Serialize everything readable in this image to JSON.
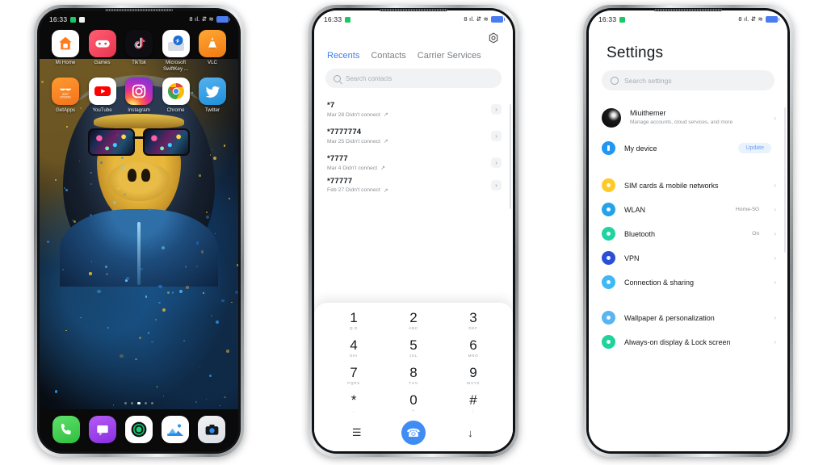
{
  "statusbar": {
    "time": "16:33",
    "signal_icons": "8 ıl. ⇵ ≋",
    "battery": "battery-full"
  },
  "phone1": {
    "name": "home-screen",
    "apps_row1": [
      {
        "label": "Mi Home",
        "icon": "mi-home-icon"
      },
      {
        "label": "Games",
        "icon": "games-icon"
      },
      {
        "label": "TikTok",
        "icon": "tiktok-icon"
      },
      {
        "label": "Microsoft SwiftKey ...",
        "icon": "swiftkey-icon"
      },
      {
        "label": "VLC",
        "icon": "vlc-icon"
      }
    ],
    "apps_row2": [
      {
        "label": "GetApps",
        "icon": "getapps-icon"
      },
      {
        "label": "YouTube",
        "icon": "youtube-icon"
      },
      {
        "label": "Instagram",
        "icon": "instagram-icon"
      },
      {
        "label": "Chrome",
        "icon": "chrome-icon"
      },
      {
        "label": "Twitter",
        "icon": "twitter-icon"
      }
    ],
    "dock": [
      {
        "label": "Phone",
        "icon": "phone-icon"
      },
      {
        "label": "Messages",
        "icon": "messages-icon"
      },
      {
        "label": "Security",
        "icon": "security-icon"
      },
      {
        "label": "Gallery",
        "icon": "gallery-icon"
      },
      {
        "label": "Camera",
        "icon": "camera-icon"
      }
    ],
    "page_dots": 5,
    "active_dot": 2,
    "wallpaper": "gorilla-in-hoodie-with-rainbow-sunglasses"
  },
  "phone2": {
    "name": "dialer-app",
    "settings_icon": "gear-icon",
    "tabs": [
      {
        "label": "Recents",
        "active": true
      },
      {
        "label": "Contacts",
        "active": false
      },
      {
        "label": "Carrier Services",
        "active": false
      }
    ],
    "search_placeholder": "Search contacts",
    "calls": [
      {
        "number": "*7",
        "detail": "Mar 28 Didn't connect"
      },
      {
        "number": "*7777774",
        "detail": "Mar 25 Didn't connect"
      },
      {
        "number": "*7777",
        "detail": "Mar 4 Didn't connect"
      },
      {
        "number": "*77777",
        "detail": "Feb 27 Didn't connect"
      }
    ],
    "keypad": [
      {
        "digit": "1",
        "letters": "Q,D"
      },
      {
        "digit": "2",
        "letters": "ABC"
      },
      {
        "digit": "3",
        "letters": "DEF"
      },
      {
        "digit": "4",
        "letters": "GHI"
      },
      {
        "digit": "5",
        "letters": "JKL"
      },
      {
        "digit": "6",
        "letters": "MNO"
      },
      {
        "digit": "7",
        "letters": "PQRS"
      },
      {
        "digit": "8",
        "letters": "TUV"
      },
      {
        "digit": "9",
        "letters": "WXYZ"
      },
      {
        "digit": "*",
        "letters": ","
      },
      {
        "digit": "0",
        "letters": "+"
      },
      {
        "digit": "#",
        "letters": ";"
      }
    ],
    "actions": {
      "menu": "menu-icon",
      "call": "call-button",
      "hide": "hide-keypad-icon"
    },
    "accent": "#3f8cf5"
  },
  "phone3": {
    "name": "settings-app",
    "title": "Settings",
    "search_placeholder": "Search settings",
    "account": {
      "name": "Miuithemer",
      "subtitle": "Manage accounts, cloud services, and more"
    },
    "device": {
      "label": "My device",
      "badge": "Update",
      "icon_color": "#2196f3"
    },
    "items_group1": [
      {
        "label": "SIM cards & mobile networks",
        "value": "",
        "icon_color": "#ffca28"
      },
      {
        "label": "WLAN",
        "value": "Home-5G",
        "icon_color": "#26a3e8"
      },
      {
        "label": "Bluetooth",
        "value": "On",
        "icon_color": "#20d3a0"
      },
      {
        "label": "VPN",
        "value": "",
        "icon_color": "#2a4fd6"
      },
      {
        "label": "Connection & sharing",
        "value": "",
        "icon_color": "#3fb8f5"
      }
    ],
    "items_group2": [
      {
        "label": "Wallpaper & personalization",
        "value": "",
        "icon_color": "#5ab4ef"
      },
      {
        "label": "Always-on display & Lock screen",
        "value": "",
        "icon_color": "#1fd39a"
      }
    ]
  }
}
